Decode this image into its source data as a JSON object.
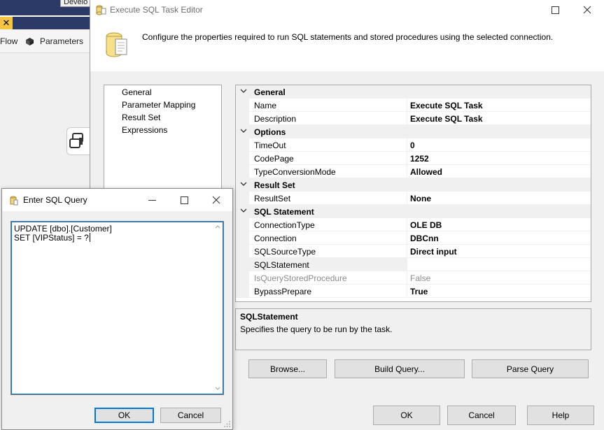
{
  "background": {
    "tab_partial": "Develo",
    "close_tab_glyph": "✕",
    "toolbar": {
      "flow_label": "Flow",
      "parameters_label": "Parameters"
    }
  },
  "main_dialog": {
    "title": "Execute SQL Task Editor",
    "header_text": "Configure the properties required to run SQL statements and stored procedures using the selected connection.",
    "nav_items": [
      "General",
      "Parameter Mapping",
      "Result Set",
      "Expressions"
    ],
    "property_grid": [
      {
        "type": "category",
        "label": "General"
      },
      {
        "type": "prop",
        "name": "Name",
        "value": "Execute SQL Task",
        "disabled": false
      },
      {
        "type": "prop",
        "name": "Description",
        "value": "Execute SQL Task",
        "disabled": false
      },
      {
        "type": "category",
        "label": "Options"
      },
      {
        "type": "prop",
        "name": "TimeOut",
        "value": "0",
        "disabled": false
      },
      {
        "type": "prop",
        "name": "CodePage",
        "value": "1252",
        "disabled": false
      },
      {
        "type": "prop",
        "name": "TypeConversionMode",
        "value": "Allowed",
        "disabled": false
      },
      {
        "type": "category",
        "label": "Result Set"
      },
      {
        "type": "prop",
        "name": "ResultSet",
        "value": "None",
        "disabled": false
      },
      {
        "type": "category",
        "label": "SQL Statement"
      },
      {
        "type": "prop",
        "name": "ConnectionType",
        "value": "OLE DB",
        "disabled": false
      },
      {
        "type": "prop",
        "name": "Connection",
        "value": "DBCnn",
        "disabled": false
      },
      {
        "type": "prop",
        "name": "SQLSourceType",
        "value": "Direct input",
        "disabled": false
      },
      {
        "type": "prop",
        "name": "SQLStatement",
        "value": "",
        "disabled": false,
        "selected": true
      },
      {
        "type": "prop",
        "name": "IsQueryStoredProcedure",
        "value": "False",
        "disabled": true
      },
      {
        "type": "prop",
        "name": "BypassPrepare",
        "value": "True",
        "disabled": false
      }
    ],
    "description": {
      "title": "SQLStatement",
      "text": "Specifies the query to be run by the task."
    },
    "buttons": {
      "browse": "Browse...",
      "build_query": "Build Query...",
      "parse_query": "Parse Query",
      "ok": "OK",
      "cancel": "Cancel",
      "help": "Help"
    }
  },
  "sql_dialog": {
    "title": "Enter SQL Query",
    "query_lines": [
      "UPDATE [dbo].[Customer]",
      "SET [VIPStatus] = ?"
    ],
    "buttons": {
      "ok": "OK",
      "cancel": "Cancel"
    }
  },
  "colors": {
    "accent_blue": "#0078d7",
    "designer_navy": "#2b3a67",
    "dialog_bg": "#f0f0f0",
    "tab_close_yellow": "#f5c542"
  }
}
